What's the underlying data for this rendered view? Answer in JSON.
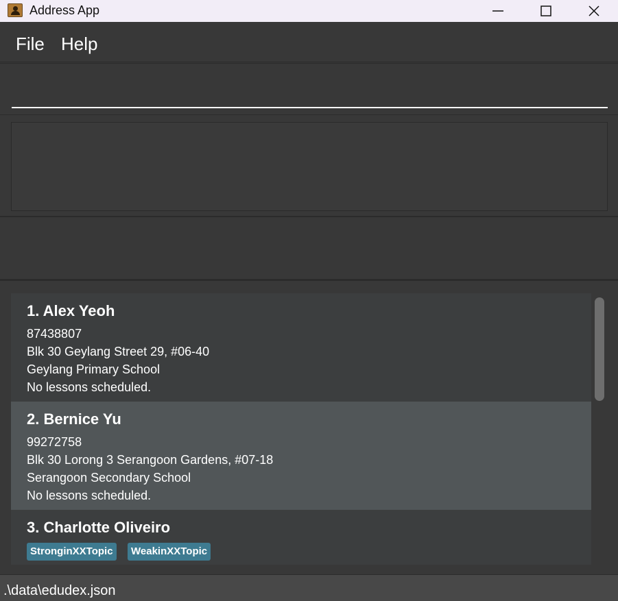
{
  "window": {
    "title": "Address App"
  },
  "menu": {
    "items": [
      {
        "label": "File"
      },
      {
        "label": "Help"
      }
    ]
  },
  "command": {
    "value": "",
    "placeholder": ""
  },
  "result": {
    "text": ""
  },
  "persons": [
    {
      "name": "1. Alex Yeoh",
      "phone": "87438807",
      "address": "Blk 30 Geylang Street 29, #06-40",
      "school": "Geylang Primary School",
      "lessons": "No lessons scheduled."
    },
    {
      "name": "2. Bernice Yu",
      "phone": "99272758",
      "address": "Blk 30 Lorong 3 Serangoon Gardens, #07-18",
      "school": "Serangoon Secondary School",
      "lessons": "No lessons scheduled."
    },
    {
      "name": "3. Charlotte Oliveiro",
      "tags": [
        "StronginXXTopic",
        "WeakinXXTopic"
      ]
    }
  ],
  "status": {
    "file_path": ".\\data\\edudex.json"
  },
  "colors": {
    "background": "#383838",
    "card_odd": "#3c3e3f",
    "card_even": "#515658",
    "tag": "#3e7b91",
    "titlebar": "#f2edf7"
  }
}
